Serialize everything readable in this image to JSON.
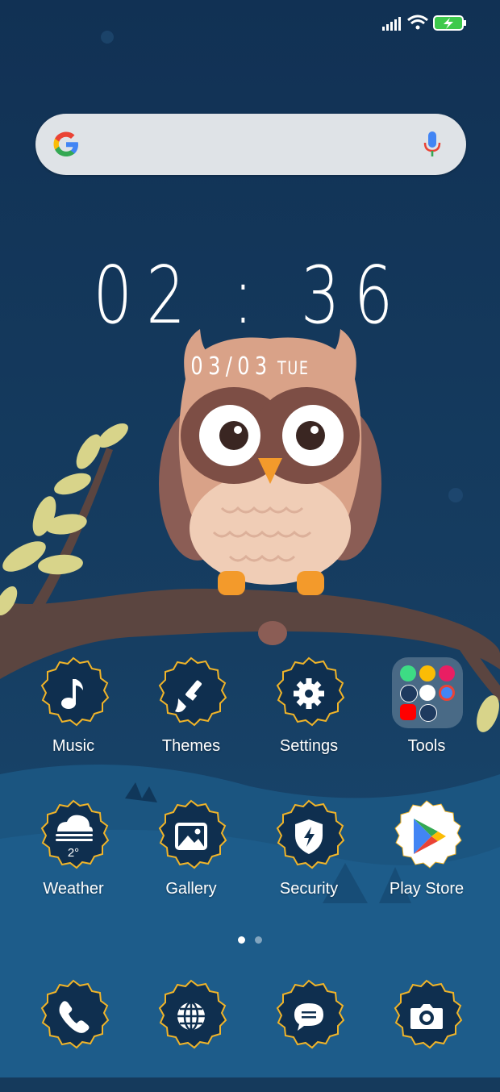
{
  "status_bar": {
    "icons": [
      "signal-icon",
      "wifi-icon",
      "battery-charging-icon"
    ]
  },
  "search_bar": {
    "icons": [
      "google-logo",
      "mic-icon"
    ]
  },
  "clock": {
    "time": "02 : 36",
    "date": "03/03",
    "day": "TUE"
  },
  "apps_row1": [
    {
      "label": "Music",
      "icon": "music-note-icon"
    },
    {
      "label": "Themes",
      "icon": "paintbrush-icon"
    },
    {
      "label": "Settings",
      "icon": "gear-icon"
    },
    {
      "label": "Tools",
      "icon": "folder-icon"
    }
  ],
  "apps_row2": [
    {
      "label": "Weather",
      "icon": "cloud-icon",
      "temp": "2°"
    },
    {
      "label": "Gallery",
      "icon": "image-icon"
    },
    {
      "label": "Security",
      "icon": "shield-icon"
    },
    {
      "label": "Play Store",
      "icon": "play-store-icon"
    }
  ],
  "dock": [
    {
      "icon": "phone-icon"
    },
    {
      "icon": "globe-icon"
    },
    {
      "icon": "message-icon"
    },
    {
      "icon": "camera-icon"
    }
  ],
  "page_indicator": {
    "pages": 2,
    "current": 1
  },
  "colors": {
    "badge_border": "#f0b429",
    "badge_fill": "#0f2f4f",
    "background": "#153a5c"
  }
}
